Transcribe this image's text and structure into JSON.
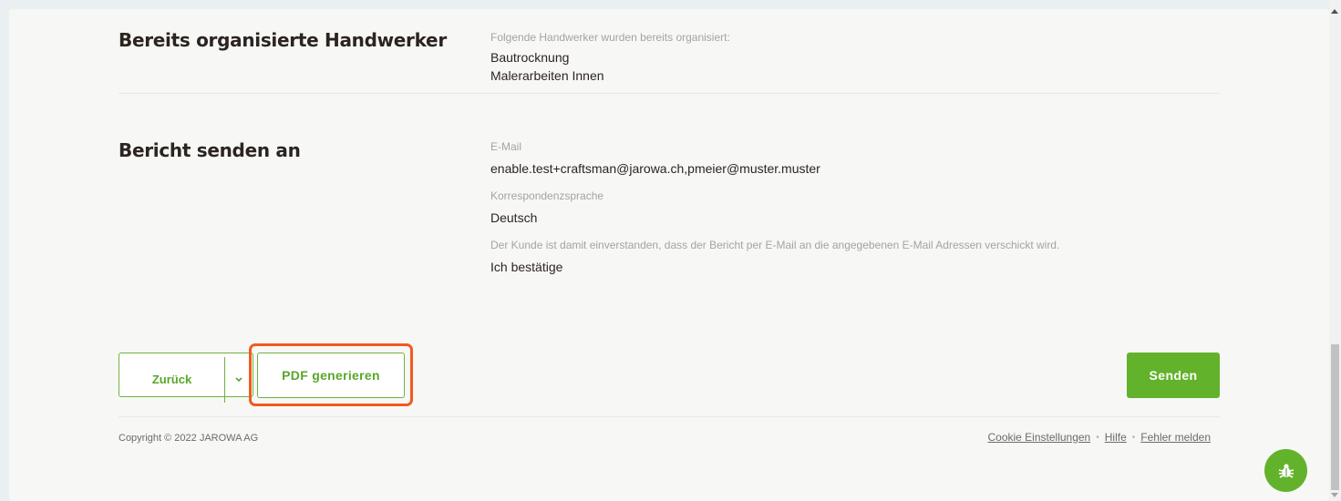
{
  "organized": {
    "title": "Bereits organisierte Handwerker",
    "label": "Folgende Handwerker wurden bereits organisiert:",
    "items": [
      "Bautrocknung",
      "Malerarbeiten Innen"
    ]
  },
  "report": {
    "title": "Bericht senden an",
    "email_label": "E-Mail",
    "email_value": "enable.test+craftsman@jarowa.ch,pmeier@muster.muster",
    "language_label": "Korrespondenzsprache",
    "language_value": "Deutsch",
    "consent_label": "Der Kunde ist damit einverstanden, dass der Bericht per E-Mail an die angegebenen E-Mail Adressen verschickt wird.",
    "consent_value": "Ich bestätige"
  },
  "actions": {
    "back_label": "Zurück",
    "pdf_label": "PDF generieren",
    "send_label": "Senden"
  },
  "footer": {
    "copyright": "Copyright © 2022 JAROWA AG",
    "links": [
      "Cookie Einstellungen",
      "Hilfe",
      "Fehler melden"
    ]
  },
  "colors": {
    "accent": "#62b22b",
    "highlight": "#f15a1f"
  },
  "icons": {
    "caret": "chevron-down-icon",
    "bug": "bug-icon"
  }
}
